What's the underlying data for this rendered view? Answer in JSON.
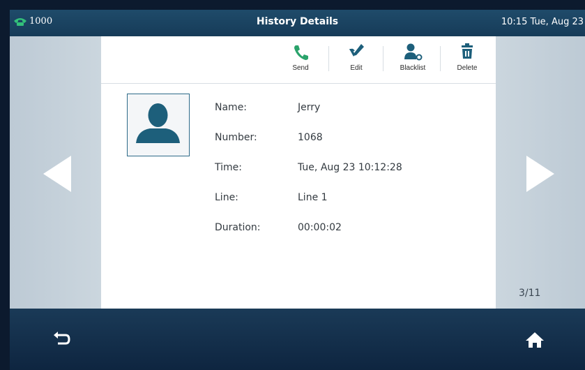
{
  "status_bar": {
    "line": "1000",
    "title": "History Details",
    "clock": "10:15 Tue, Aug 23"
  },
  "toolbar": {
    "send_label": "Send",
    "edit_label": "Edit",
    "blacklist_label": "Blacklist",
    "delete_label": "Delete"
  },
  "details": {
    "name_label": "Name:",
    "name_value": "Jerry",
    "number_label": "Number:",
    "number_value": "1068",
    "time_label": "Time:",
    "time_value": "Tue, Aug 23 10:12:28",
    "line_label": "Line:",
    "line_value": "Line 1",
    "duration_label": "Duration:",
    "duration_value": "00:00:02"
  },
  "pager": {
    "indicator": "3/11"
  },
  "icons": {
    "line_status": "phone-handset-icon",
    "send": "phone-call-icon",
    "edit": "edit-pen-icon",
    "blacklist": "person-block-icon",
    "delete": "trash-icon",
    "avatar": "person-silhouette-icon",
    "back": "back-arrow-icon",
    "home": "home-icon",
    "prev": "triangle-left-icon",
    "next": "triangle-right-icon"
  },
  "colors": {
    "accent_green": "#2aa36b",
    "icon_teal": "#1d5f7b",
    "status_bar": "#1f4b6a"
  }
}
